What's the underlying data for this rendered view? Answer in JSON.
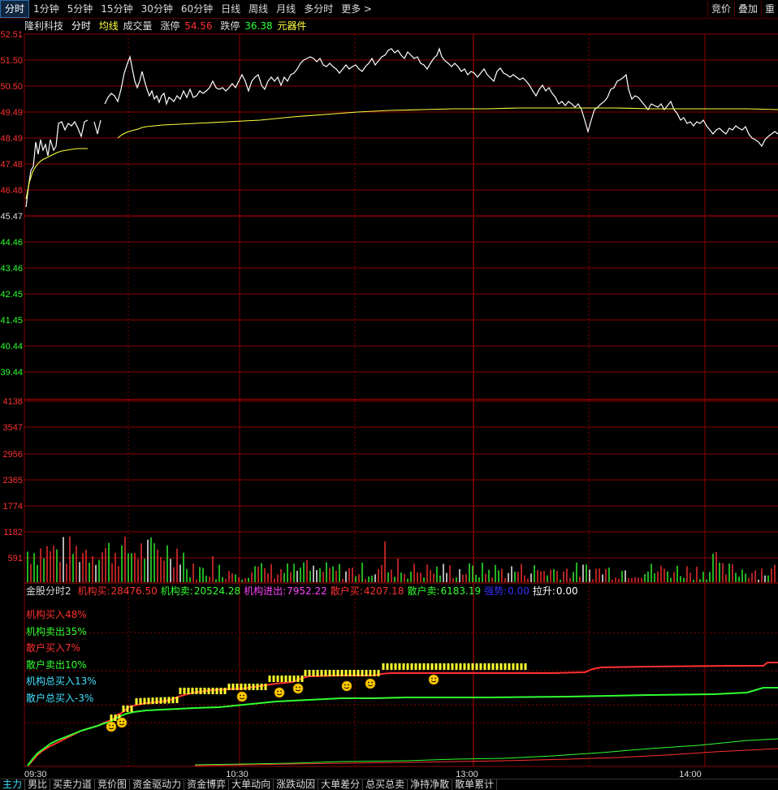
{
  "toolbar": {
    "periods": [
      "分时",
      "1分钟",
      "5分钟",
      "15分钟",
      "30分钟",
      "60分钟",
      "日线",
      "周线",
      "月线",
      "多分时",
      "更多 >"
    ],
    "right": [
      "竞价",
      "叠加",
      "重"
    ]
  },
  "info": {
    "stock_name": "隆利科技",
    "tab": "分时",
    "avg_line": "均线",
    "volume": "成交量",
    "limit_up_label": "涨停",
    "limit_up": "54.56",
    "limit_down_label": "跌停",
    "limit_down": "36.38",
    "sector": "元器件"
  },
  "price_axis": {
    "labels": [
      "52.51",
      "51.50",
      "50.50",
      "49.49",
      "48.49",
      "47.48",
      "46.48",
      "45.47",
      "44.46",
      "43.46",
      "42.45",
      "41.45",
      "40.44",
      "39.44"
    ],
    "ref_price": "45.47"
  },
  "volume_axis": {
    "labels": [
      "4138",
      "3547",
      "2956",
      "2365",
      "1774",
      "1182",
      "591"
    ]
  },
  "indicator": {
    "name": "金股分时2",
    "items": [
      {
        "label": "机构买:",
        "value": "28476.50",
        "color": "#ff3030"
      },
      {
        "label": "机构卖:",
        "value": "20524.28",
        "color": "#30ff30"
      },
      {
        "label": "机构进出:",
        "value": "7952.22",
        "color": "#ff40ff"
      },
      {
        "label": "散户买:",
        "value": "4207.18",
        "color": "#ff3030"
      },
      {
        "label": "散户卖:",
        "value": "6183.19",
        "color": "#30ff30"
      },
      {
        "label": "强势:",
        "value": "0.00",
        "color": "#3030ff"
      },
      {
        "label": "拉升:",
        "value": "0.00",
        "color": "#ffffff"
      }
    ],
    "list": [
      {
        "text": "机构买入48%",
        "color": "#ff3030"
      },
      {
        "text": "机构卖出35%",
        "color": "#30ff30"
      },
      {
        "text": "散户买入7%",
        "color": "#ff3030"
      },
      {
        "text": "散户卖出10%",
        "color": "#30ff30"
      },
      {
        "text": "机构总买入13%",
        "color": "#40e0ff"
      },
      {
        "text": "散户总买入-3%",
        "color": "#40e0ff"
      }
    ]
  },
  "time_axis": [
    "09:30",
    "10:30",
    "13:00",
    "14:00"
  ],
  "bottom_tabs": [
    "主力",
    "男比",
    "买卖力道",
    "竞价图",
    "资金驱动力",
    "资金博弈",
    "大单动向",
    "涨跌动因",
    "大单差分",
    "总买总卖",
    "净持净散",
    "散单累计"
  ],
  "colors": {
    "grid": "#8b0000",
    "price_line": "#ffffff",
    "avg_line": "#ffff40",
    "up": "#ff3030",
    "down": "#30ff30",
    "flat": "#ffffff"
  }
}
